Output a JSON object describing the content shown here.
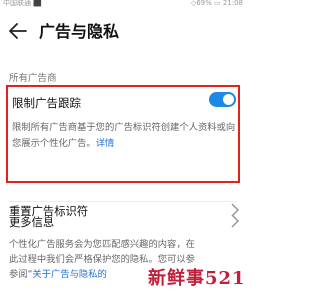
{
  "status_bar": {
    "carrier": "中国联通 ⬛",
    "right": "◇69% ▭ 21:08"
  },
  "header": {
    "title": "广告与隐私"
  },
  "section": {
    "label": "所有广告商"
  },
  "ad_tracking": {
    "title": "限制广告跟踪",
    "toggle_on": true,
    "description": "限制所有广告商基于您的广告标识符创建个人资料或向您展示个性化广告。",
    "details_link": "详情"
  },
  "rows": {
    "reset_label": "重置广告标识符",
    "more_label": "更多信息"
  },
  "footer": {
    "text_line1": "个性化广告服务会为您匹配感兴趣的内容，在",
    "text_line2": "此过程中我们会严格保护您的隐私。您可以参",
    "text_prefix": "参阅",
    "link": "“关于广告与隐私的"
  },
  "watermark": "新鲜事521",
  "colors": {
    "accent": "#1e88e5",
    "highlight": "#e2231a",
    "link": "#1e6fd9",
    "watermark": "#c21f3a"
  }
}
